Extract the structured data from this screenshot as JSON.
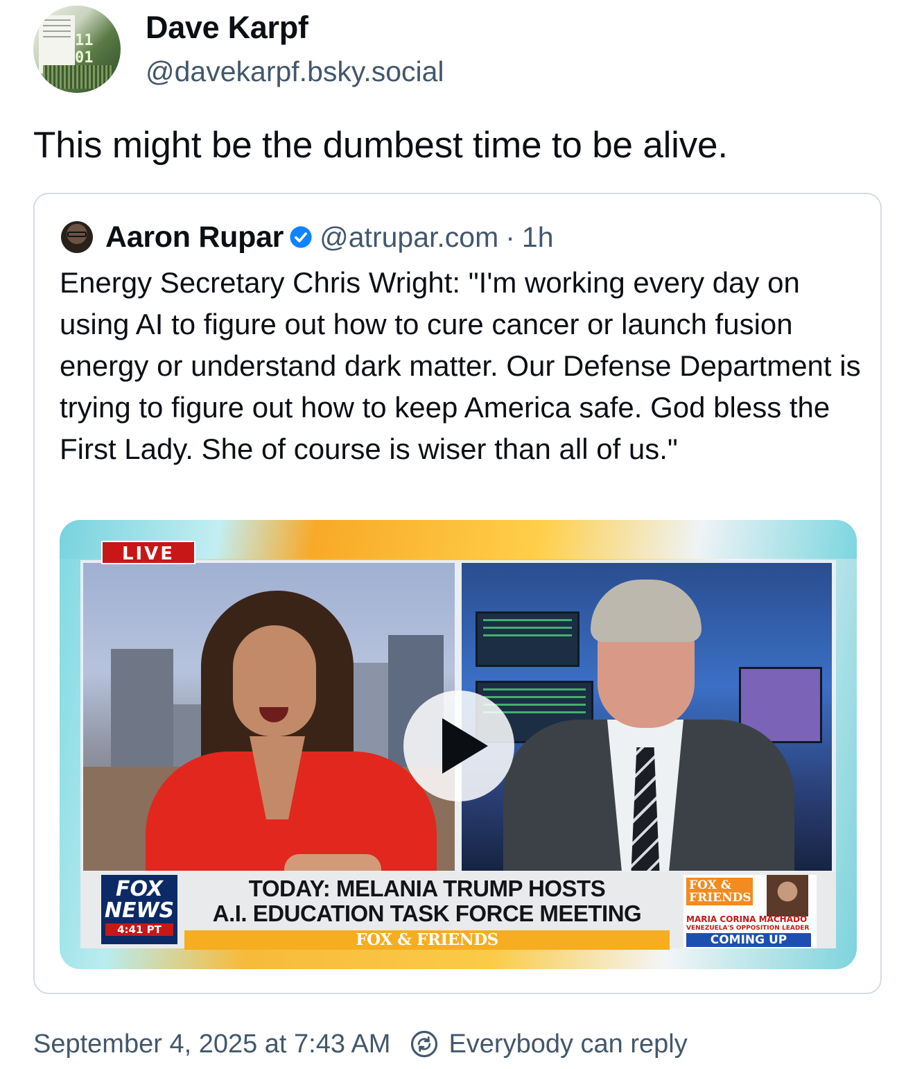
{
  "author": {
    "display_name": "Dave Karpf",
    "handle": "@davekarpf.bsky.social",
    "avatar_icon": "book-cover-avatar"
  },
  "post": {
    "text": "This might be the dumbest time to be alive."
  },
  "quoted_post": {
    "display_name": "Aaron Rupar",
    "verified_icon": "verified-check-icon",
    "handle": "@atrupar.com",
    "separator": "·",
    "time": "1h",
    "text": "Energy Secretary Chris Wright: \"I'm working every day on using AI to figure out how to cure cancer or launch fusion energy or understand dark matter. Our Defense Department is trying to figure out how to keep America safe. God bless the First Lady. She of course is wiser than all of us.\"",
    "video": {
      "live_badge": "LIVE",
      "network_logo_line1": "FOX",
      "network_logo_line2": "NEWS",
      "clock": "4:41 PT",
      "headline_line1": "TODAY: MELANIA TRUMP HOSTS",
      "headline_line2": "A.I. EDUCATION TASK FORCE MEETING",
      "show_name": "FOX & FRIENDS",
      "upnext_logo": "FOX & FRIENDS",
      "upnext_name": "MARIA CORINA MACHADO",
      "upnext_subtitle": "VENEZUELA'S OPPOSITION LEADER",
      "upnext_label": "COMING UP",
      "play_icon": "play-icon"
    }
  },
  "footer": {
    "timestamp": "September 4, 2025 at 7:43 AM",
    "reply_icon": "reply-settings-icon",
    "reply_setting": "Everybody can reply"
  },
  "colors": {
    "text": "#0b0f14",
    "secondary_text": "#42576c",
    "border": "#d4dbe2",
    "verified_blue": "#1083fe"
  }
}
